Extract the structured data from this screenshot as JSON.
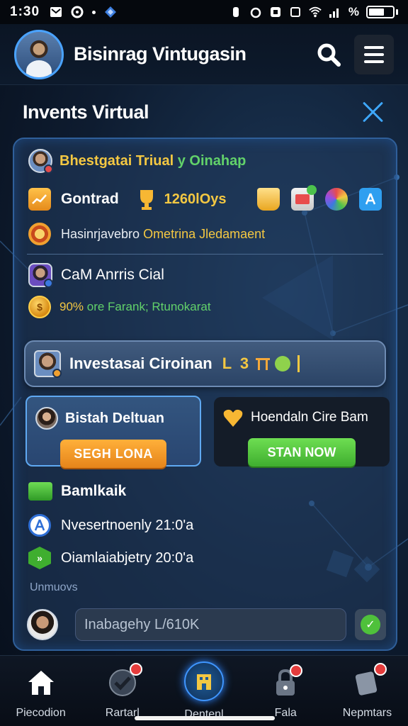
{
  "status_bar": {
    "time": "1:30",
    "signal": "%"
  },
  "header": {
    "app_title": "Bisinrag Vintugasin"
  },
  "section": {
    "title": "Invents Virtual"
  },
  "panel": {
    "row1": {
      "text_a": "Bhestgatai Triual",
      "text_b": " y Oinahap"
    },
    "row2": {
      "label": "Gontrad",
      "value": "1260lOys"
    },
    "row3": {
      "text_a": "Hasinrjavebro ",
      "text_b": "Ometrina Jledamaent"
    },
    "row4": {
      "text": "CaM Anrris Cial"
    },
    "row5": {
      "text_a": "90% ",
      "text_b": "ore Farank; Rtunokarat"
    },
    "invest": {
      "title": "Investasai Ciroinan",
      "extra": "L 3"
    },
    "card_left": {
      "title": "Bistah Deltuan",
      "button": "SEGH LONA"
    },
    "card_right": {
      "title": "Hoendaln Cire Bam",
      "button": "STAN NOW"
    },
    "list_heading": "Bamlkaik",
    "list": [
      {
        "text": "Nvesertnoenly 21:0'a"
      },
      {
        "text": "Oiamlaiabjetry 20:0'a"
      }
    ],
    "footer_label": "Unmuovs",
    "chat": {
      "placeholder": "Inabagehy L/610K"
    }
  },
  "nav": [
    {
      "label": "Piecodion",
      "icon": "home-icon"
    },
    {
      "label": "Rartarl",
      "icon": "checklist-icon"
    },
    {
      "label": "Dentenl",
      "icon": "building-icon"
    },
    {
      "label": "Fala",
      "icon": "lock-icon"
    },
    {
      "label": "Nepmtars",
      "icon": "device-icon"
    }
  ]
}
